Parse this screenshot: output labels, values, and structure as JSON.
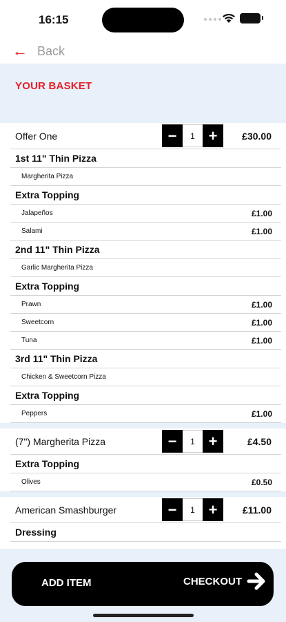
{
  "status_bar": {
    "time": "16:15"
  },
  "nav": {
    "back_label": "Back",
    "back_icon": "arrow-left-icon"
  },
  "header": {
    "title": "YOUR BASKET"
  },
  "basket": [
    {
      "name": "Offer One",
      "quantity": "1",
      "price": "£30.00",
      "sections": [
        {
          "title": "1st 11\" Thin Pizza",
          "details": [
            {
              "name": "Margherita Pizza",
              "price": ""
            }
          ]
        },
        {
          "title": "Extra Topping",
          "details": [
            {
              "name": "Jalapeños",
              "price": "£1.00"
            },
            {
              "name": "Salami",
              "price": "£1.00"
            }
          ]
        },
        {
          "title": "2nd 11\" Thin Pizza",
          "details": [
            {
              "name": "Garlic Margherita Pizza",
              "price": ""
            }
          ]
        },
        {
          "title": "Extra Topping",
          "details": [
            {
              "name": "Prawn",
              "price": "£1.00"
            },
            {
              "name": "Sweetcorn",
              "price": "£1.00"
            },
            {
              "name": "Tuna",
              "price": "£1.00"
            }
          ]
        },
        {
          "title": "3rd 11\" Thin Pizza",
          "details": [
            {
              "name": "Chicken & Sweetcorn Pizza",
              "price": ""
            }
          ]
        },
        {
          "title": "Extra Topping",
          "details": [
            {
              "name": "Peppers",
              "price": "£1.00"
            }
          ]
        }
      ]
    },
    {
      "name": "(7\") Margherita Pizza",
      "quantity": "1",
      "price": "£4.50",
      "sections": [
        {
          "title": "Extra Topping",
          "details": [
            {
              "name": "Olives",
              "price": "£0.50"
            }
          ]
        }
      ]
    },
    {
      "name": "American Smashburger",
      "quantity": "1",
      "price": "£11.00",
      "sections": [
        {
          "title": "Dressing",
          "details": []
        }
      ]
    }
  ],
  "stepper": {
    "minus": "−",
    "plus": "+"
  },
  "actions": {
    "add_item_label": "ADD ITEM",
    "checkout_label": "CHECKOUT",
    "checkout_icon": "arrow-right-icon"
  },
  "colors": {
    "accent": "#e8202a",
    "panel": "#e8f0fa",
    "action_bar": "#000000"
  }
}
